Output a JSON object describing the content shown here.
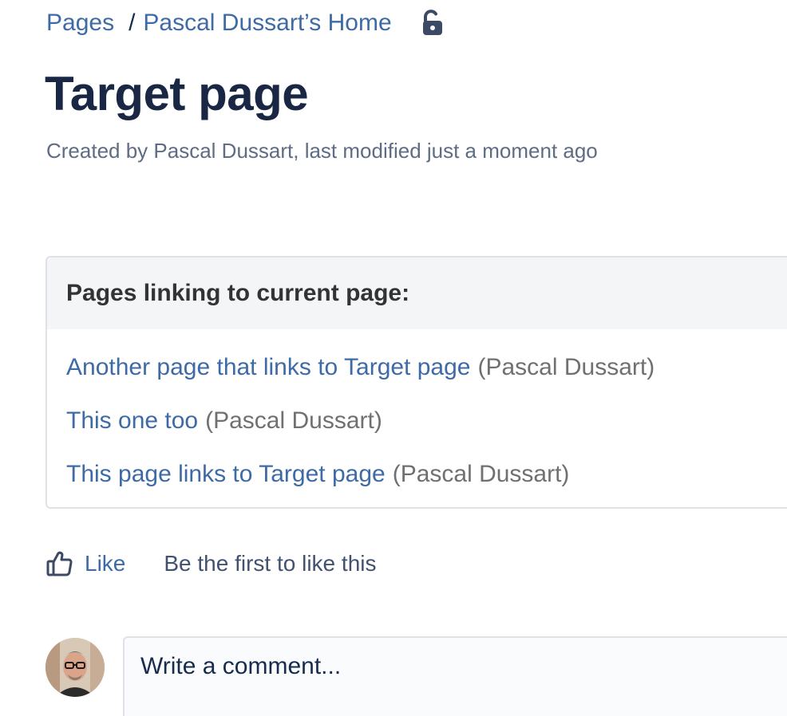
{
  "breadcrumb": {
    "root": "Pages",
    "separator": "/",
    "home": "Pascal Dussart’s Home",
    "restriction_icon": "unlocked-padlock-icon"
  },
  "page": {
    "title": "Target page",
    "meta": "Created by Pascal Dussart, last modified just a moment ago"
  },
  "incoming_links": {
    "heading": "Pages linking to current page:",
    "items": [
      {
        "title": "Another page that links to Target page",
        "author": "(Pascal Dussart)"
      },
      {
        "title": "This one too",
        "author": "(Pascal Dussart)"
      },
      {
        "title": "This page links to Target page",
        "author": "(Pascal Dussart)"
      }
    ]
  },
  "likes": {
    "icon": "thumbs-up-icon",
    "button_label": "Like",
    "summary": "Be the first to like this"
  },
  "comment": {
    "avatar_icon": "user-avatar",
    "placeholder": "Write a comment..."
  },
  "colors": {
    "link": "#3e6aa6",
    "heading": "#1a2744",
    "meta": "#5e6c84",
    "panel_header_bg": "#f4f5f7",
    "author_gray": "#707070"
  }
}
